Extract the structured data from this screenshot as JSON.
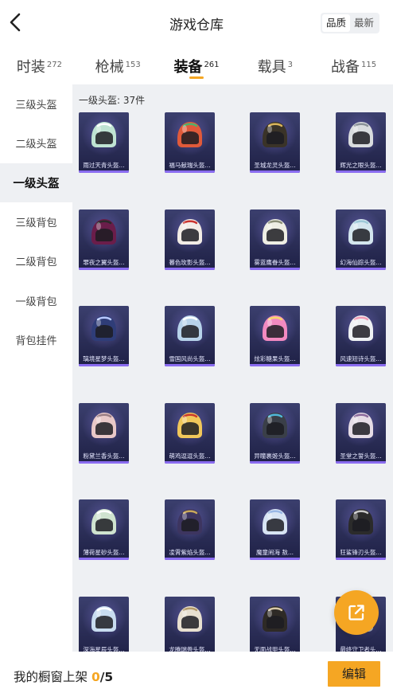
{
  "header": {
    "title": "游戏仓库",
    "sort_options": [
      "品质",
      "最新"
    ],
    "sort_selected": "品质"
  },
  "tabs": [
    {
      "label": "时装",
      "count": "272"
    },
    {
      "label": "枪械",
      "count": "153"
    },
    {
      "label": "装备",
      "count": "261",
      "active": true
    },
    {
      "label": "载具",
      "count": "3"
    },
    {
      "label": "战备",
      "count": "115"
    }
  ],
  "sidebar": {
    "items": [
      {
        "label": "三级头盔"
      },
      {
        "label": "二级头盔"
      },
      {
        "label": "一级头盔",
        "active": true
      },
      {
        "label": "三级背包"
      },
      {
        "label": "二级背包"
      },
      {
        "label": "一级背包"
      },
      {
        "label": "背包挂件"
      }
    ]
  },
  "main": {
    "section_title": "一级头盔: 37件",
    "items": [
      {
        "name": "雨过天青头盔...",
        "color": "#bfe3d2",
        "accent": "#ffffff"
      },
      {
        "name": "福马献瑞头盔...",
        "color": "#e05a3a",
        "accent": "#4fb06a"
      },
      {
        "name": "圣城龙灵头盔...",
        "color": "#3a3328",
        "accent": "#d9b45a"
      },
      {
        "name": "辉光之眼头盔...",
        "color": "#d9dcde",
        "accent": "#8a9198"
      },
      {
        "name": "罪夜之翼头盔...",
        "color": "#6a1d4a",
        "accent": "#2a2a2a"
      },
      {
        "name": "暮色玫影头盔...",
        "color": "#f2ece6",
        "accent": "#c9332e"
      },
      {
        "name": "雾蓝鹰眷头盔...",
        "color": "#eeeee4",
        "accent": "#8b8f78"
      },
      {
        "name": "幻海仙踪头盔...",
        "color": "#d4e6ee",
        "accent": "#9ec9d8"
      },
      {
        "name": "璃境星梦头盔...",
        "color": "#2f3d78",
        "accent": "#b8c8ff"
      },
      {
        "name": "雪国风尚头盔...",
        "color": "#b7d3ea",
        "accent": "#ffffff"
      },
      {
        "name": "炫彩糖果头盔...",
        "color": "#f28ac0",
        "accent": "#f7d86a"
      },
      {
        "name": "风速短诗头盔...",
        "color": "#eef1f3",
        "accent": "#f29bb5"
      },
      {
        "name": "粉黛兰香头盔...",
        "color": "#e8c8c8",
        "accent": "#9a7e84"
      },
      {
        "name": "萌鸡逗逗头盔...",
        "color": "#f1c75a",
        "accent": "#c93a2c"
      },
      {
        "name": "异瞳裹姬头盔...",
        "color": "#3a3f48",
        "accent": "#4fb7d8"
      },
      {
        "name": "圣堂之誓头盔...",
        "color": "#e6dde6",
        "accent": "#8b6a9c"
      },
      {
        "name": "薄荷星砂头盔...",
        "color": "#cfe3cf",
        "accent": "#ffffff"
      },
      {
        "name": "凌霄紫焰头盔...",
        "color": "#3d3560",
        "accent": "#c9a85a"
      },
      {
        "name": "魔童闹海 敖...",
        "color": "#d8e4f4",
        "accent": "#9ab8e6"
      },
      {
        "name": "狂鲨锋刃头盔...",
        "color": "#2b2b2b",
        "accent": "#c9c9c9"
      },
      {
        "name": "深海星辰头盔...",
        "color": "#c8dcf0",
        "accent": "#ffffff"
      },
      {
        "name": "龙腾瑞兽头盔...",
        "color": "#e8e0d0",
        "accent": "#b49a6a"
      },
      {
        "name": "无面战甲头盔...",
        "color": "#2e2a26",
        "accent": "#d8c8a8"
      },
      {
        "name": "最终守卫者头...",
        "color": "#b8bcc0",
        "accent": "#e8e8e8"
      }
    ]
  },
  "fab": {
    "icon": "share-out-icon"
  },
  "bottom": {
    "label": "我的橱窗上架",
    "count": "0",
    "total": "/5",
    "edit_label": "编辑"
  },
  "colors": {
    "accent": "#f5a623",
    "panel": "#eef0f3",
    "card_bar": "#8a6cf0"
  }
}
